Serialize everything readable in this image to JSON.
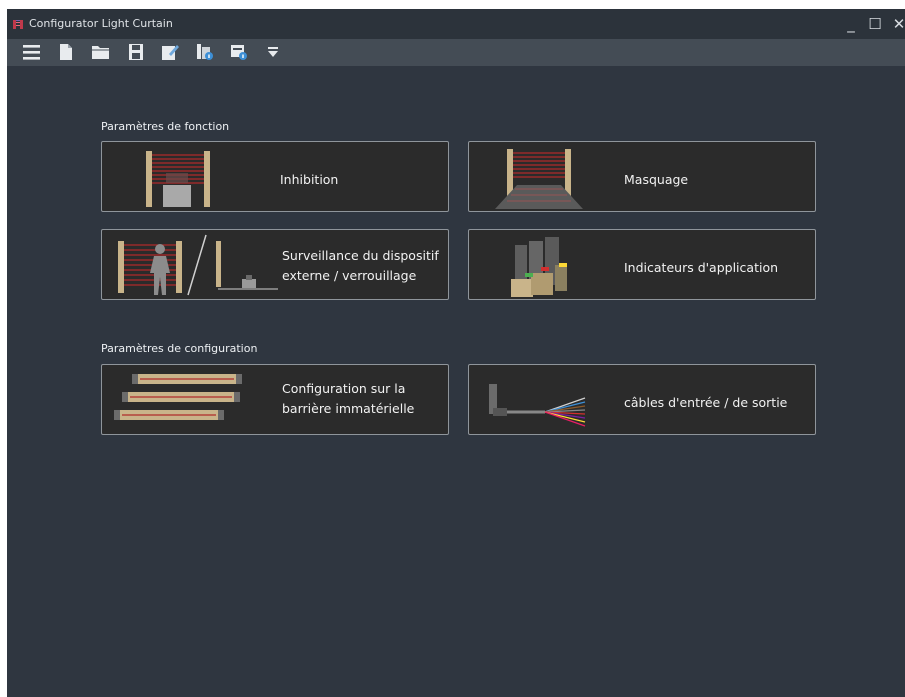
{
  "window": {
    "title": "Configurator Light Curtain",
    "controls": {
      "minimize": "_",
      "maximize": "☐",
      "close": "✕"
    }
  },
  "toolbar": {
    "buttons": [
      {
        "name": "menu-icon"
      },
      {
        "name": "new-file-icon"
      },
      {
        "name": "open-folder-icon"
      },
      {
        "name": "save-icon"
      },
      {
        "name": "edit-icon"
      },
      {
        "name": "info-icon"
      },
      {
        "name": "device-info-icon"
      },
      {
        "name": "dropdown-arrow-icon"
      }
    ]
  },
  "sections": {
    "function": {
      "label": "Paramètres de fonction",
      "tiles": [
        {
          "label": "Inhibition",
          "icon": "muting-icon"
        },
        {
          "label": "Masquage",
          "icon": "blanking-icon"
        },
        {
          "label": "Surveillance du dispositif\nexterne  / verrouillage",
          "icon": "edm-restart-interlock-icon"
        },
        {
          "label": "Indicateurs d'application",
          "icon": "application-indicators-icon"
        }
      ]
    },
    "configuration": {
      "label": "Paramètres de configuration",
      "tiles": [
        {
          "label": "Configuration sur la\nbarrière immatérielle",
          "icon": "light-curtain-config-icon"
        },
        {
          "label": "câbles d'entrée / de sortie",
          "icon": "io-cables-icon"
        }
      ]
    }
  },
  "colors": {
    "window_bg": "#2f3640",
    "toolbar_bg": "#444c55",
    "tile_bg": "#2b2b2b",
    "tile_border": "#8f959b",
    "beam_red": "#b02a2a",
    "post_tan": "#c9b48a"
  }
}
